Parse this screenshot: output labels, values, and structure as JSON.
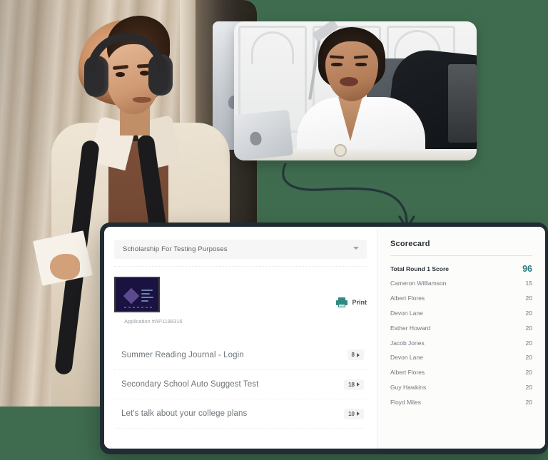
{
  "theme": {
    "background": "#3f6c4f",
    "bezel": "#1f2d33",
    "accent_teal": "#2e7d83",
    "print_icon_color": "#2e8b84"
  },
  "photos": {
    "student": {
      "alt": "Student wearing headphones and a backpack standing outside a building"
    },
    "counselor": {
      "alt": "Woman in white blouse working at a desk with a laptop"
    }
  },
  "arrow": {
    "name": "curved-arrow-connector"
  },
  "app": {
    "selector": {
      "value": "Scholarship For Testing Purposes",
      "chevron": "chevron-down-icon"
    },
    "document": {
      "thumbnail_alt": "Application document thumbnail",
      "caption": "Application #AP1188316",
      "print_label": "Print",
      "print_icon": "printer-icon"
    },
    "items": [
      {
        "label": "Summer Reading Journal - Login",
        "count": "8"
      },
      {
        "label": "Secondary School Auto Suggest Test",
        "count": "18"
      },
      {
        "label": "Let's talk about your college plans",
        "count": "10"
      }
    ],
    "scorecard": {
      "title": "Scorecard",
      "total_label": "Total Round 1 Score",
      "total_value": "96",
      "rows": [
        {
          "name": "Cameron Williamson",
          "score": "15"
        },
        {
          "name": "Albert Flores",
          "score": "20"
        },
        {
          "name": "Devon Lane",
          "score": "20"
        },
        {
          "name": "Esther Howard",
          "score": "20"
        },
        {
          "name": "Jacob Jones",
          "score": "20"
        },
        {
          "name": "Devon Lane",
          "score": "20"
        },
        {
          "name": "Albert Flores",
          "score": "20"
        },
        {
          "name": "Guy Hawkins",
          "score": "20"
        },
        {
          "name": "Floyd Miles",
          "score": "20"
        }
      ]
    }
  }
}
